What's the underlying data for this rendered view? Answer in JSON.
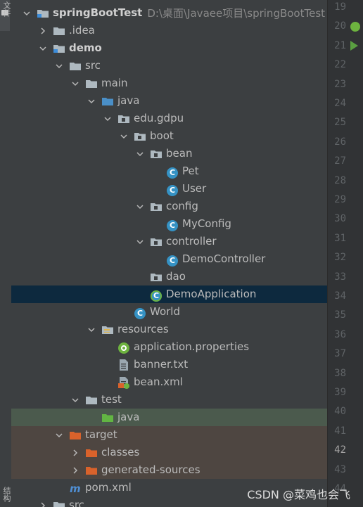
{
  "left_strip": {
    "tab_text_top": "文件",
    "tab_text_bottom": "结构"
  },
  "tree": [
    {
      "label": "springBootTest",
      "hint": "D:\\桌面\\Javaee项目\\springBootTest",
      "depth": 0,
      "arrow": "down",
      "icon": "module-folder-icon",
      "bold": true
    },
    {
      "label": ".idea",
      "depth": 1,
      "arrow": "right",
      "icon": "folder-icon"
    },
    {
      "label": "demo",
      "depth": 1,
      "arrow": "down",
      "icon": "module-folder-icon",
      "bold": true
    },
    {
      "label": "src",
      "depth": 2,
      "arrow": "down",
      "icon": "folder-icon"
    },
    {
      "label": "main",
      "depth": 3,
      "arrow": "down",
      "icon": "folder-icon"
    },
    {
      "label": "java",
      "depth": 4,
      "arrow": "down",
      "icon": "source-folder-icon"
    },
    {
      "label": "edu.gdpu",
      "depth": 5,
      "arrow": "down",
      "icon": "package-icon"
    },
    {
      "label": "boot",
      "depth": 6,
      "arrow": "down",
      "icon": "package-icon"
    },
    {
      "label": "bean",
      "depth": 7,
      "arrow": "down",
      "icon": "package-icon"
    },
    {
      "label": "Pet",
      "depth": 8,
      "arrow": "none",
      "icon": "class-icon"
    },
    {
      "label": "User",
      "depth": 8,
      "arrow": "none",
      "icon": "class-icon"
    },
    {
      "label": "config",
      "depth": 7,
      "arrow": "down",
      "icon": "package-icon"
    },
    {
      "label": "MyConfig",
      "depth": 8,
      "arrow": "none",
      "icon": "class-icon"
    },
    {
      "label": "controller",
      "depth": 7,
      "arrow": "down",
      "icon": "package-icon"
    },
    {
      "label": "DemoController",
      "depth": 8,
      "arrow": "none",
      "icon": "class-icon"
    },
    {
      "label": "dao",
      "depth": 7,
      "arrow": "none",
      "icon": "package-icon"
    },
    {
      "label": "DemoApplication",
      "depth": 7,
      "arrow": "none",
      "icon": "spring-boot-class-icon",
      "selected": true
    },
    {
      "label": "World",
      "depth": 6,
      "arrow": "none",
      "icon": "class-icon"
    },
    {
      "label": "resources",
      "depth": 4,
      "arrow": "down",
      "icon": "resources-folder-icon"
    },
    {
      "label": "application.properties",
      "depth": 5,
      "arrow": "none",
      "icon": "spring-properties-icon"
    },
    {
      "label": "banner.txt",
      "depth": 5,
      "arrow": "none",
      "icon": "text-file-icon"
    },
    {
      "label": "bean.xml",
      "depth": 5,
      "arrow": "none",
      "icon": "spring-xml-icon"
    },
    {
      "label": "test",
      "depth": 3,
      "arrow": "down",
      "icon": "folder-icon"
    },
    {
      "label": "java",
      "depth": 4,
      "arrow": "none",
      "icon": "test-source-folder-icon",
      "tint": "test"
    },
    {
      "label": "target",
      "depth": 2,
      "arrow": "down",
      "icon": "excluded-folder-icon",
      "tint": "excluded"
    },
    {
      "label": "classes",
      "depth": 3,
      "arrow": "right",
      "icon": "excluded-folder-icon",
      "tint": "excluded"
    },
    {
      "label": "generated-sources",
      "depth": 3,
      "arrow": "right",
      "icon": "excluded-folder-icon",
      "tint": "excluded"
    },
    {
      "label": "pom.xml",
      "depth": 2,
      "arrow": "none",
      "icon": "maven-icon"
    },
    {
      "label": "src",
      "depth": 1,
      "arrow": "right",
      "icon": "folder-icon"
    }
  ],
  "gutter": {
    "line_numbers": [
      "19",
      "20",
      "21",
      "22",
      "23",
      "24",
      "25",
      "26",
      "27",
      "28",
      "29",
      "30",
      "31",
      "32",
      "33",
      "34",
      "35",
      "36",
      "37",
      "38",
      "39",
      "40",
      "41",
      "42",
      "43",
      "44"
    ],
    "current_line": "42"
  },
  "watermark": "CSDN @菜鸡也会飞",
  "colors": {
    "selection": "#0d293e",
    "test_tint": "#4b5a4d",
    "excluded_tint": "#4e4641",
    "class_badge": "#3592c4",
    "spring_green": "#6db33f",
    "source_folder": "#4a8fc7",
    "excluded_folder": "#d9622b",
    "test_folder": "#62b543"
  }
}
